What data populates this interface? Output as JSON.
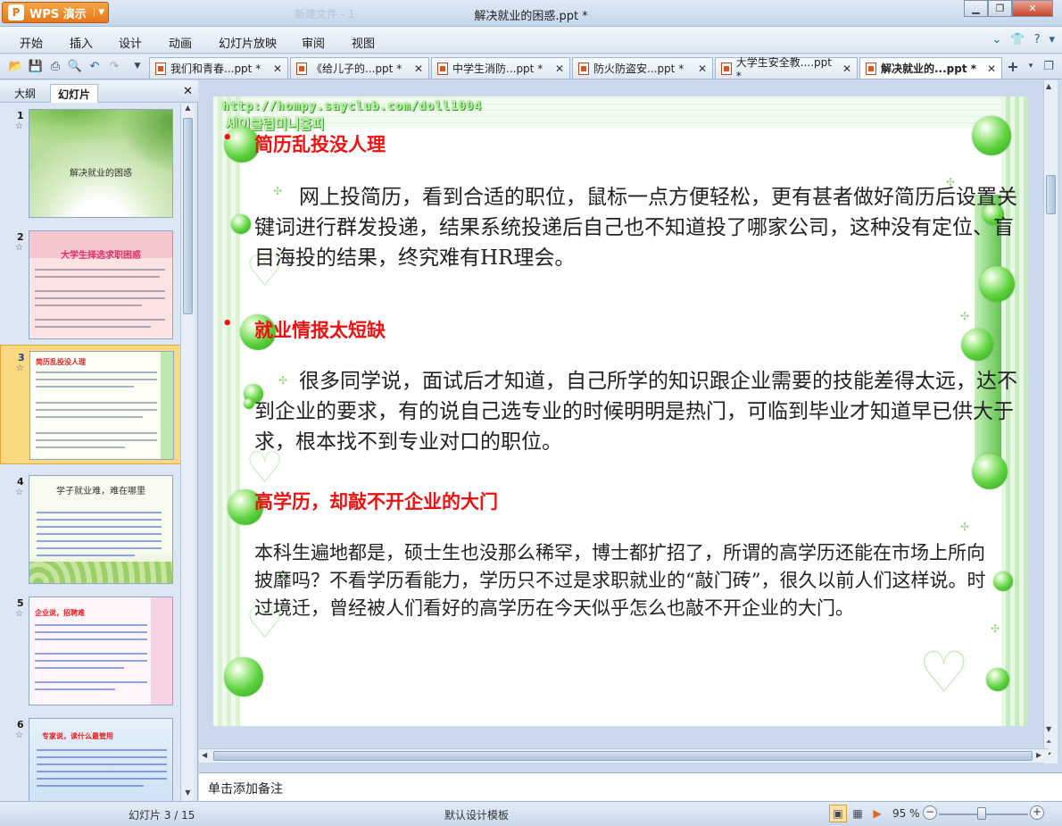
{
  "window": {
    "app_button": "WPS 演示",
    "title": "解决就业的困惑.ppt *",
    "faded_title": "新建文件 - 1"
  },
  "menu": [
    "开始",
    "插入",
    "设计",
    "动画",
    "幻灯片放映",
    "审阅",
    "视图"
  ],
  "tabs": [
    {
      "label": "我们和青春...ppt *"
    },
    {
      "label": "《给儿子的...ppt *"
    },
    {
      "label": "中学生消防...ppt *"
    },
    {
      "label": "防火防盗安...ppt *"
    },
    {
      "label": "大学生安全教....ppt *"
    },
    {
      "label": "解决就业的...ppt *"
    }
  ],
  "left_panel": {
    "tab_outline": "大纲",
    "tab_slides": "幻灯片",
    "thumbnails": [
      {
        "num": "1",
        "title": "解决就业的困惑"
      },
      {
        "num": "2",
        "title": "大学生择选求职困惑"
      },
      {
        "num": "3",
        "title": "简历乱投没人理"
      },
      {
        "num": "4",
        "title": "学子就业难，难在哪里"
      },
      {
        "num": "5",
        "title": "企业说，招聘难"
      },
      {
        "num": "6",
        "title": "专家说，读什么最管用"
      }
    ]
  },
  "slide": {
    "deco_url": "http://hompy.sayclub.com/doll1004",
    "deco_korean": "세이클럽미니홈피",
    "sections": [
      {
        "heading": "简历乱投没人理",
        "text": "网上投简历，看到合适的职位，鼠标一点方便轻松，更有甚者做好简历后设置关键词进行群发投递，结果系统投递后自己也不知道投了哪家公司，这种没有定位、盲目海投的结果，终究难有HR理会。"
      },
      {
        "heading": "就业情报太短缺",
        "text": "很多同学说，面试后才知道，自己所学的知识跟企业需要的技能差得太远，达不到企业的要求，有的说自己选专业的时候明明是热门，可临到毕业才知道早已供大于求，根本找不到专业对口的职位。"
      },
      {
        "heading": "高学历，却敲不开企业的大门",
        "text": "本科生遍地都是，硕士生也没那么稀罕，博士都扩招了，所谓的高学历还能在市场上所向披靡吗？不看学历看能力，学历只不过是求职就业的“敲门砖”，很久以前人们这样说。时过境迁，曾经被人们看好的高学历在今天似乎怎么也敲不开企业的大门。"
      }
    ]
  },
  "notes_placeholder": "单击添加备注",
  "status": {
    "slide_counter": "幻灯片 3 / 15",
    "template": "默认设计模板",
    "zoom": "95 %"
  },
  "icons": [
    "new-folder-icon",
    "save-icon",
    "print-icon",
    "print-preview-icon",
    "undo-icon",
    "redo-icon",
    "close-icon",
    "add-tab-icon",
    "help-icon",
    "skin-icon"
  ]
}
